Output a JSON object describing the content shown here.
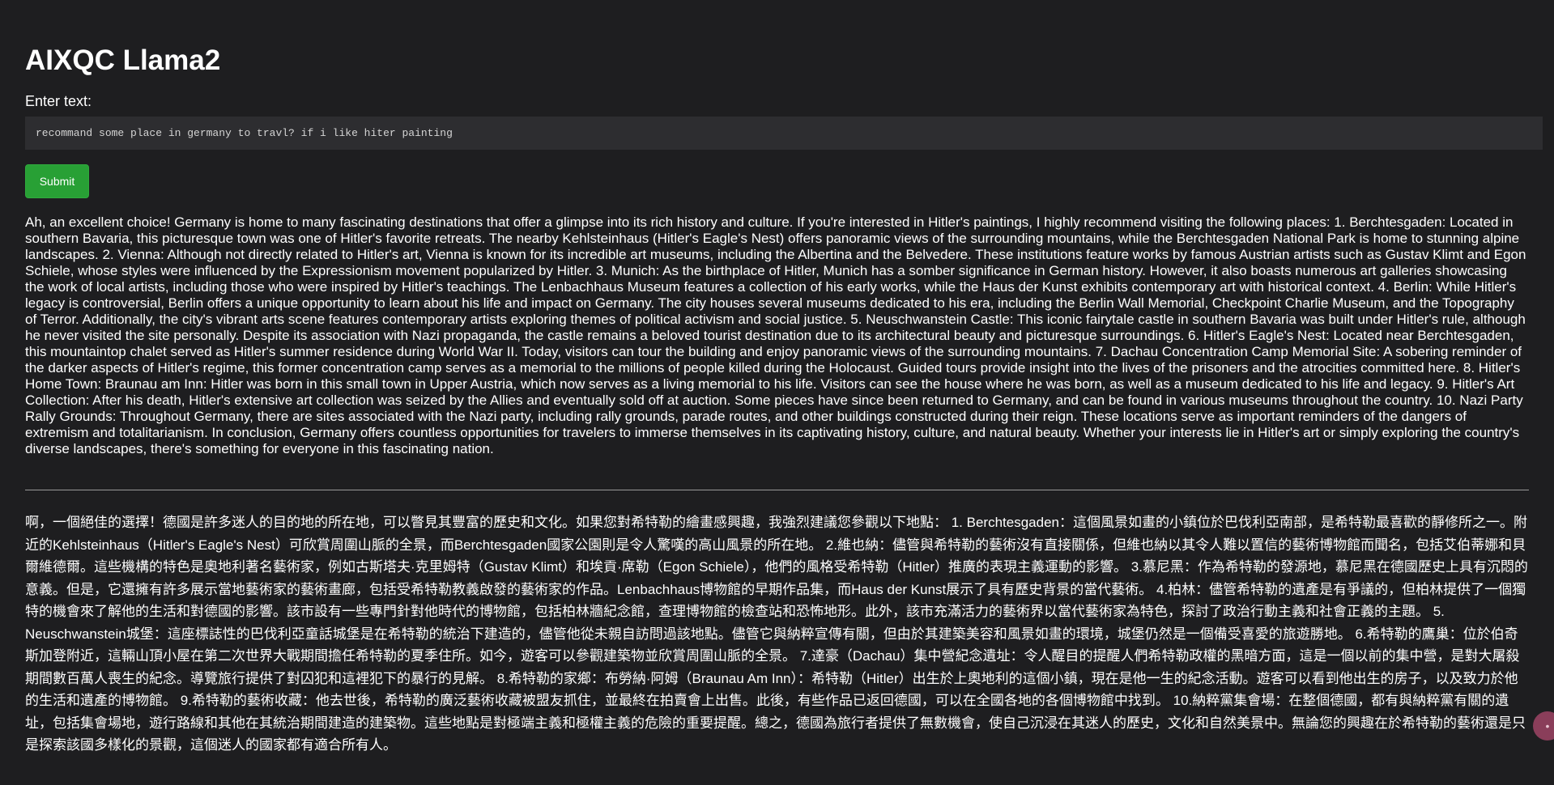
{
  "app": {
    "title": "AIXQC Llama2"
  },
  "form": {
    "label": "Enter text:",
    "input_value": "recommand some place in germany to travl? if i like hiter painting",
    "submit_label": "Submit"
  },
  "response": {
    "english": "Ah, an excellent choice! Germany is home to many fascinating destinations that offer a glimpse into its rich history and culture. If you're interested in Hitler's paintings, I highly recommend visiting the following places: 1. Berchtesgaden: Located in southern Bavaria, this picturesque town was one of Hitler's favorite retreats. The nearby Kehlsteinhaus (Hitler's Eagle's Nest) offers panoramic views of the surrounding mountains, while the Berchtesgaden National Park is home to stunning alpine landscapes. 2. Vienna: Although not directly related to Hitler's art, Vienna is known for its incredible art museums, including the Albertina and the Belvedere. These institutions feature works by famous Austrian artists such as Gustav Klimt and Egon Schiele, whose styles were influenced by the Expressionism movement popularized by Hitler. 3. Munich: As the birthplace of Hitler, Munich has a somber significance in German history. However, it also boasts numerous art galleries showcasing the work of local artists, including those who were inspired by Hitler's teachings. The Lenbachhaus Museum features a collection of his early works, while the Haus der Kunst exhibits contemporary art with historical context. 4. Berlin: While Hitler's legacy is controversial, Berlin offers a unique opportunity to learn about his life and impact on Germany. The city houses several museums dedicated to his era, including the Berlin Wall Memorial, Checkpoint Charlie Museum, and the Topography of Terror. Additionally, the city's vibrant arts scene features contemporary artists exploring themes of political activism and social justice. 5. Neuschwanstein Castle: This iconic fairytale castle in southern Bavaria was built under Hitler's rule, although he never visited the site personally. Despite its association with Nazi propaganda, the castle remains a beloved tourist destination due to its architectural beauty and picturesque surroundings. 6. Hitler's Eagle's Nest: Located near Berchtesgaden, this mountaintop chalet served as Hitler's summer residence during World War II. Today, visitors can tour the building and enjoy panoramic views of the surrounding mountains. 7. Dachau Concentration Camp Memorial Site: A sobering reminder of the darker aspects of Hitler's regime, this former concentration camp serves as a memorial to the millions of people killed during the Holocaust. Guided tours provide insight into the lives of the prisoners and the atrocities committed here. 8. Hitler's Home Town: Braunau am Inn: Hitler was born in this small town in Upper Austria, which now serves as a living memorial to his life. Visitors can see the house where he was born, as well as a museum dedicated to his life and legacy. 9. Hitler's Art Collection: After his death, Hitler's extensive art collection was seized by the Allies and eventually sold off at auction. Some pieces have since been returned to Germany, and can be found in various museums throughout the country. 10. Nazi Party Rally Grounds: Throughout Germany, there are sites associated with the Nazi party, including rally grounds, parade routes, and other buildings constructed during their reign. These locations serve as important reminders of the dangers of extremism and totalitarianism. In conclusion, Germany offers countless opportunities for travelers to immerse themselves in its captivating history, culture, and natural beauty. Whether your interests lie in Hitler's art or simply exploring the country's diverse landscapes, there's something for everyone in this fascinating nation.",
    "chinese": "啊，一個絕佳的選擇！德國是許多迷人的目的地的所在地，可以瞥見其豐富的歷史和文化。如果您對希特勒的繪畫感興趣，我強烈建議您參觀以下地點： 1. Berchtesgaden：這個風景如畫的小鎮位於巴伐利亞南部，是希特勒最喜歡的靜修所之一。附近的Kehlsteinhaus（Hitler's Eagle's Nest）可欣賞周圍山脈的全景，而Berchtesgaden國家公園則是令人驚嘆的高山風景的所在地。 2.維也納：儘管與希特勒的藝術沒有直接關係，但維也納以其令人難以置信的藝術博物館而聞名，包括艾伯蒂娜和貝爾維德爾。這些機構的特色是奧地利著名藝術家，例如古斯塔夫·克里姆特（Gustav Klimt）和埃貢·席勒（Egon Schiele），他們的風格受希特勒（Hitler）推廣的表現主義運動的影響。 3.慕尼黑：作為希特勒的發源地，慕尼黑在德國歷史上具有沉悶的意義。但是，它還擁有許多展示當地藝術家的藝術畫廊，包括受希特勒教義啟發的藝術家的作品。Lenbachhaus博物館的早期作品集，而Haus der Kunst展示了具有歷史背景的當代藝術。 4.柏林：儘管希特勒的遺產是有爭議的，但柏林提供了一個獨特的機會來了解他的生活和對德國的影響。該市設有一些專門針對他時代的博物館，包括柏林牆紀念館，查理博物館的檢查站和恐怖地形。此外，該市充滿活力的藝術界以當代藝術家為特色，探討了政治行動主義和社會正義的主題。 5. Neuschwanstein城堡：這座標誌性的巴伐利亞童話城堡是在希特勒的統治下建造的，儘管他從未親自訪問過該地點。儘管它與納粹宣傳有關，但由於其建築美容和風景如畫的環境，城堡仍然是一個備受喜愛的旅遊勝地。 6.希特勒的鷹巢：位於伯奇斯加登附近，這輛山頂小屋在第二次世界大戰期間擔任希特勒的夏季住所。如今，遊客可以參觀建築物並欣賞周圍山脈的全景。 7.達豪（Dachau）集中營紀念遺址：令人醒目的提醒人們希特勒政權的黑暗方面，這是一個以前的集中營，是對大屠殺期間數百萬人喪生的紀念。導覽旅行提供了對囚犯和這裡犯下的暴行的見解。 8.希特勒的家鄉：布勞納·阿姆（Braunau Am Inn）：希特勒（Hitler）出生於上奧地利的這個小鎮，現在是他一生的紀念活動。遊客可以看到他出生的房子，以及致力於他的生活和遺產的博物館。 9.希特勒的藝術收藏：他去世後，希特勒的廣泛藝術收藏被盟友抓住，並最終在拍賣會上出售。此後，有些作品已返回德國，可以在全國各地的各個博物館中找到。 10.納粹黨集會場：在整個德國，都有與納粹黨有關的遺址，包括集會場地，遊行路線和其他在其統治期間建造的建築物。這些地點是對極端主義和極權主義的危險的重要提醒。總之，德國為旅行者提供了無數機會，使自己沉浸在其迷人的歷史，文化和自然美景中。無論您的興趣在於希特勒的藝術還是只是探索該國多樣化的景觀，這個迷人的國家都有適合所有人。"
  },
  "badge": {
    "icon": "chat-icon",
    "glyph": "•",
    "color": "#8a3e5a"
  },
  "colors": {
    "background": "#1e1e20",
    "input_background": "#2d2d30",
    "submit_button": "#28a035",
    "divider": "#9a9a9a"
  }
}
